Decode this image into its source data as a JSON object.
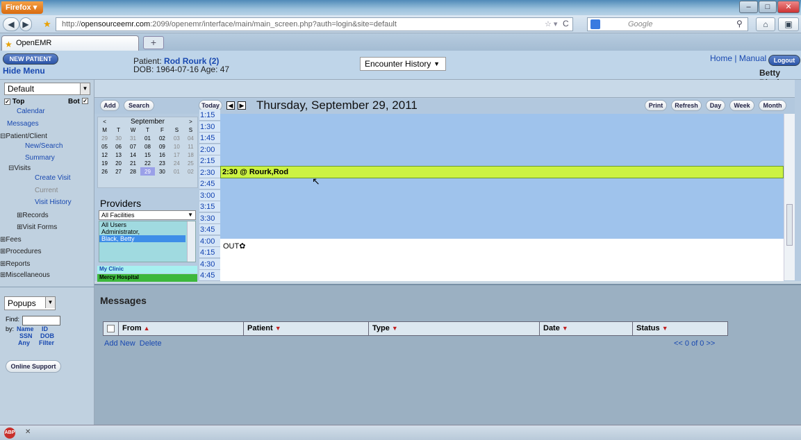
{
  "browser": {
    "menu_label": "Firefox",
    "url_host": "opensourceemr.com",
    "url_prefix": "http://",
    "url_rest": ":2099/openemr/interface/main/main_screen.php?auth=login&site=default",
    "search_placeholder": "Google",
    "tab_title": "OpenEMR",
    "new_tab": "+"
  },
  "header": {
    "new_patient": "NEW PATIENT",
    "hide_menu": "Hide Menu",
    "patient_label": "Patient: ",
    "patient_name": "Rod Rourk (2)",
    "dob_age": "DOB: 1964-07-16 Age: 47",
    "encounter_select": "Encounter History",
    "home": "Home",
    "sep": "|",
    "manual": "Manual",
    "logout": "Logout",
    "user": "Betty Black"
  },
  "leftmenu": {
    "view_select": "Default",
    "top": "Top",
    "bot": "Bot",
    "items": {
      "calendar": "Calendar",
      "messages": "Messages",
      "patient_client": "Patient/Client",
      "new_search": "New/Search",
      "summary": "Summary",
      "visits": "Visits",
      "create_visit": "Create Visit",
      "current": "Current",
      "visit_history": "Visit History",
      "records": "Records",
      "visit_forms": "Visit Forms",
      "fees": "Fees",
      "procedures": "Procedures",
      "reports": "Reports",
      "misc": "Miscellaneous"
    },
    "popups": "Popups",
    "find_label": "Find:",
    "by_label": "by:",
    "find_links": {
      "name": "Name",
      "id": "ID",
      "ssn": "SSN",
      "dob": "DOB",
      "any": "Any",
      "filter": "Filter"
    },
    "online_support": "Online Support"
  },
  "calendar": {
    "buttons": {
      "add": "Add",
      "search": "Search",
      "today": "Today",
      "print": "Print",
      "refresh": "Refresh",
      "day": "Day",
      "week": "Week",
      "month": "Month"
    },
    "date_title": "Thursday, September 29, 2011",
    "mini": {
      "prev": "<",
      "next": ">",
      "month": "September",
      "dow": [
        "M",
        "T",
        "W",
        "T",
        "F",
        "S",
        "S"
      ],
      "weeks": [
        [
          "29",
          "30",
          "31",
          "01",
          "02",
          "03",
          "04"
        ],
        [
          "05",
          "06",
          "07",
          "08",
          "09",
          "10",
          "11"
        ],
        [
          "12",
          "13",
          "14",
          "15",
          "16",
          "17",
          "18"
        ],
        [
          "19",
          "20",
          "21",
          "22",
          "23",
          "24",
          "25"
        ],
        [
          "26",
          "27",
          "28",
          "29",
          "30",
          "01",
          "02"
        ]
      ],
      "selected": "29"
    },
    "providers_label": "Providers",
    "facility": "All Facilities",
    "users": [
      "All Users",
      "Administrator,",
      "Black, Betty"
    ],
    "clinics": [
      "My Clinic",
      "Mercy Hospital"
    ],
    "times": [
      "1:15",
      "1:30",
      "1:45",
      "2:00",
      "2:15",
      "2:30",
      "2:45",
      "3:00",
      "3:15",
      "3:30",
      "3:45",
      "4:00",
      "4:15",
      "4:30",
      "4:45"
    ],
    "appointment": "2:30 @ Rourk,Rod",
    "out_label": "OUT"
  },
  "messages": {
    "title": "Messages",
    "columns": [
      "From",
      "Patient",
      "Type",
      "Date",
      "Status"
    ],
    "add_new": "Add New",
    "delete": "Delete",
    "pager": "<<  0 of 0  >>"
  },
  "colors": {
    "appointment": "#ccf243",
    "appt_area": "#9fc3ec",
    "link": "#1848b0"
  }
}
